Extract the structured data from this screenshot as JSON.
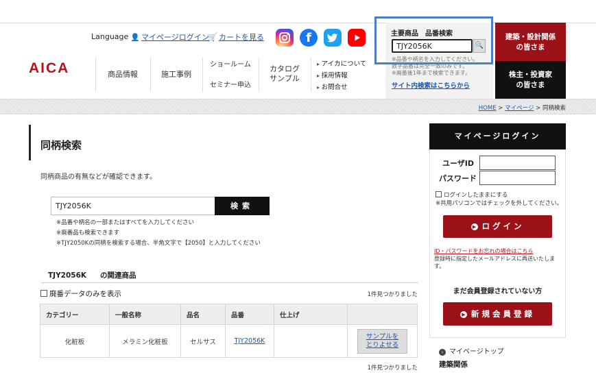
{
  "header": {
    "language_label": "Language",
    "mypage_login_link": "マイページログイン",
    "cart_link": "カートを見る",
    "logo_text": "AICA",
    "nav": {
      "products": "商品情報",
      "cases": "施工事例",
      "showroom": "ショールーム",
      "seminar": "セミナー申込",
      "catalog_line1": "カタログ",
      "catalog_line2": "サンプル",
      "about": "アイカについて",
      "recruit": "採用情報",
      "contact": "お問合せ"
    },
    "product_search": {
      "title": "主要商品　品番検索",
      "value": "TJY2056K",
      "note1": "※品番や柄名を入力してください。",
      "note2": "数字品番は完全一致のみです。",
      "note3": "※廃番後1年まで検索できます。",
      "site_search_link": "サイト内検索はこちらから"
    },
    "side_red": {
      "line1": "建築・設計関係",
      "line2": "の皆さま"
    },
    "side_black": {
      "line1": "株主・投資家",
      "line2": "の皆さま"
    }
  },
  "breadcrumb": {
    "home": "HOME",
    "mypage": "マイページ",
    "current": "同柄検索",
    "sep": ">"
  },
  "main": {
    "title": "同柄検索",
    "description": "同柄商品の有無などが確認できます。",
    "search_value": "TJY2056K",
    "search_button": "検索",
    "notes": [
      "※品番や柄名の一部またはすべてを入力してください",
      "※廃番品も検索できます",
      "※TJY2050Kの同柄を検索する場合、半角文字で【2050】と入力してください"
    ],
    "related_code": "TJY2056K",
    "related_suffix": "の関連商品",
    "discontinued_only": "廃番データのみを表示",
    "result_count": "1件見つかりました",
    "table": {
      "headers": [
        "カテゴリー",
        "一般名称",
        "品名",
        "品番",
        "仕上げ",
        ""
      ],
      "rows": [
        {
          "category": "化粧板",
          "general_name": "メラミン化粧板",
          "product_name": "セルサス",
          "product_code": "TJY2056K",
          "finish": "",
          "sample_line1": "サンプルを",
          "sample_line2": "とりよせる"
        }
      ]
    }
  },
  "login": {
    "heading": "マイページログイン",
    "user_id_label": "ユーザID",
    "password_label": "パスワード",
    "remember": "ログインしたままにする",
    "remember_note": "※共用パソコンではチェックを外してください。",
    "login_button": "ログイン",
    "forgot_link": "ID・パスワードをお忘れの場合はこちら",
    "forgot_note": "登録時に指定したメールアドレスに再送いたします。",
    "not_registered": "まだ会員登録されていない方",
    "register_button": "新規会員登録",
    "mypage_top": "マイページトップ",
    "section_label": "建築関係"
  },
  "colors": {
    "brand_red": "#9c1017",
    "link_blue": "#1a56b8",
    "highlight_blue": "#4a7ec7"
  }
}
